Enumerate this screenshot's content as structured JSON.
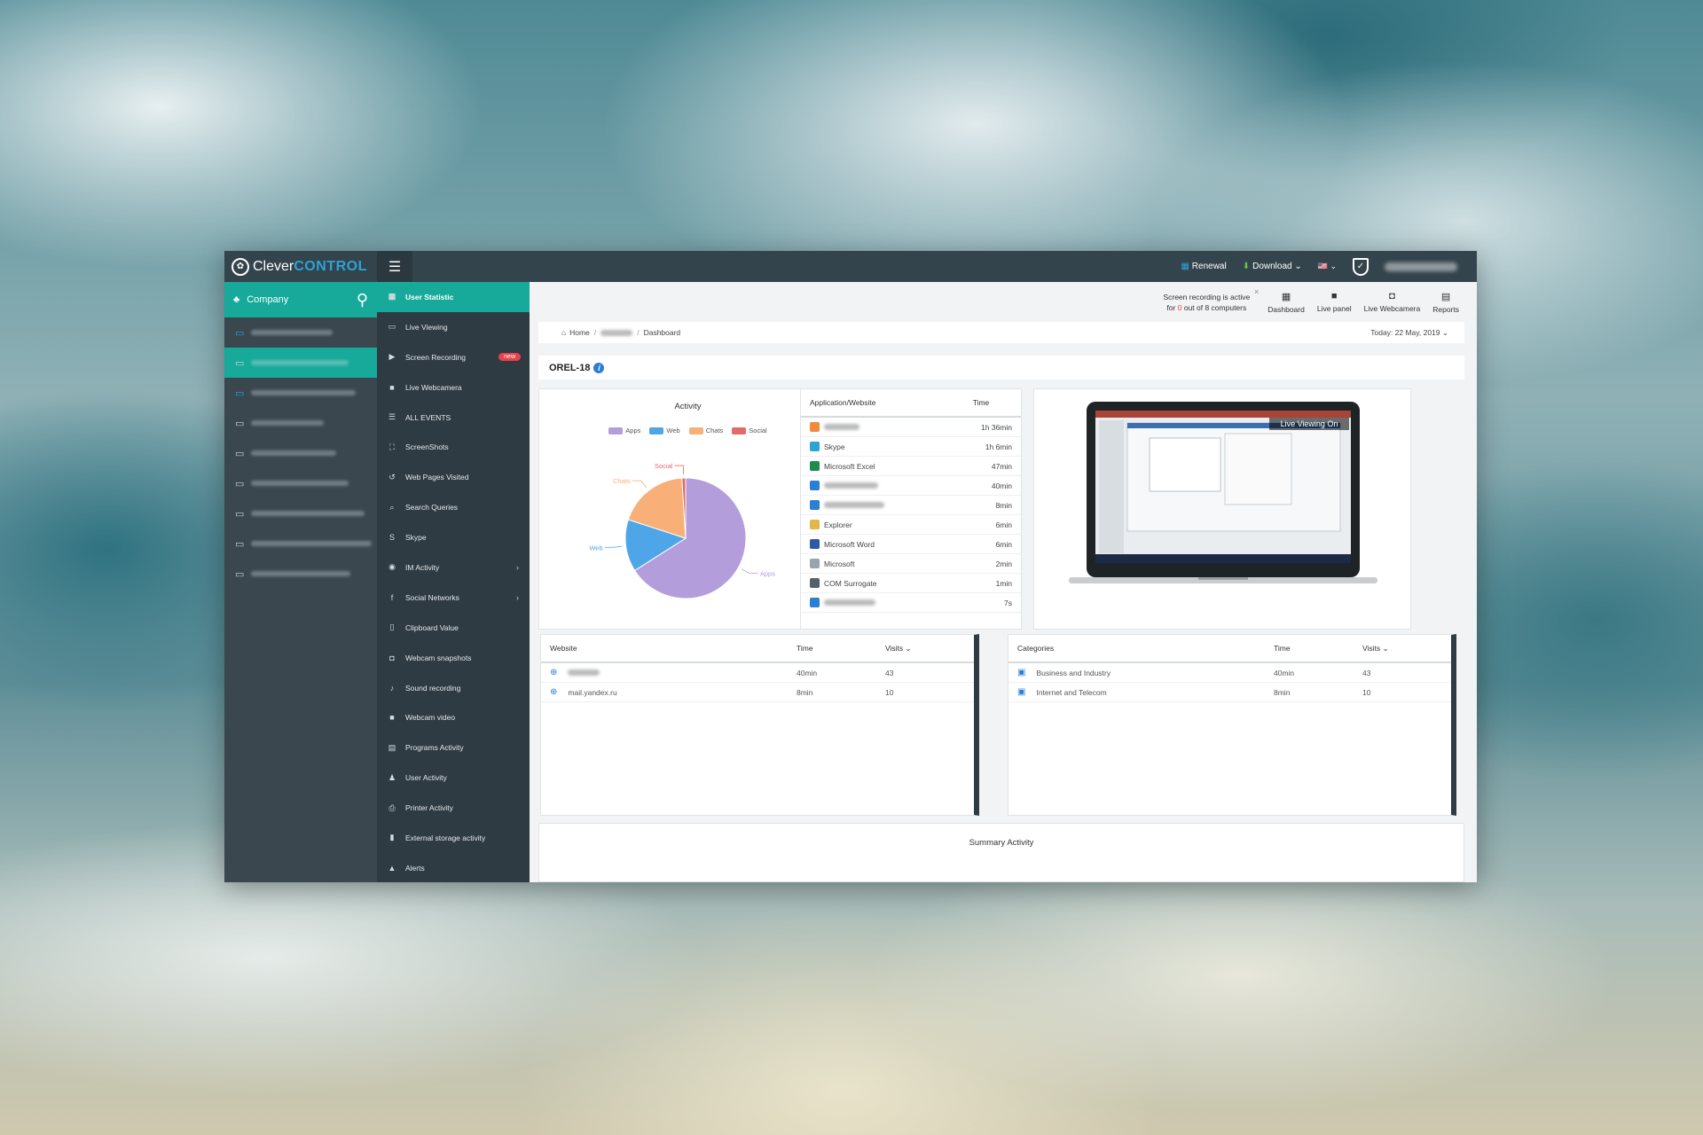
{
  "app": {
    "logo_prefix": "Clever",
    "logo_accent": "CONTROL",
    "menu_icon": "hamburger-icon"
  },
  "topbar": {
    "renewal": "Renewal",
    "download": "Download ⌄",
    "language": "🇺🇸 ⌄"
  },
  "company": {
    "label": "Company"
  },
  "computers_count": 9,
  "menu": [
    {
      "label": "User Statistic",
      "icon": "▦"
    },
    {
      "label": "Live Viewing",
      "icon": "▭"
    },
    {
      "label": "Screen Recording",
      "icon": "▶",
      "badge": "new"
    },
    {
      "label": "Live Webcamera",
      "icon": "■"
    },
    {
      "label": "ALL EVENTS",
      "icon": "☰"
    },
    {
      "label": "ScreenShots",
      "icon": "⛶"
    },
    {
      "label": "Web Pages Visited",
      "icon": "↺"
    },
    {
      "label": "Search Queries",
      "icon": "⌕"
    },
    {
      "label": "Skype",
      "icon": "S"
    },
    {
      "label": "IM Activity",
      "icon": "◉",
      "chevron": "›"
    },
    {
      "label": "Social Networks",
      "icon": "f",
      "chevron": "›"
    },
    {
      "label": "Clipboard Value",
      "icon": "▯"
    },
    {
      "label": "Webcam snapshots",
      "icon": "◘"
    },
    {
      "label": "Sound recording",
      "icon": "♪"
    },
    {
      "label": "Webcam video",
      "icon": "■"
    },
    {
      "label": "Programs Activity",
      "icon": "▤"
    },
    {
      "label": "User Activity",
      "icon": "♟"
    },
    {
      "label": "Printer Activity",
      "icon": "⎙"
    },
    {
      "label": "External storage activity",
      "icon": "▮"
    },
    {
      "label": "Alerts",
      "icon": "▲"
    }
  ],
  "info_strip": {
    "rec_line1": "Screen recording is active",
    "rec_prefix": "for",
    "rec_count": "0",
    "rec_suffix": "out of 8 computers",
    "close": "×",
    "quick_links": [
      {
        "label": "Dashboard",
        "icon": "▦"
      },
      {
        "label": "Live panel",
        "icon": "■"
      },
      {
        "label": "Live Webcamera",
        "icon": "◘"
      },
      {
        "label": "Reports",
        "icon": "▤"
      }
    ]
  },
  "breadcrumb": {
    "home": "Home",
    "current": "Dashboard",
    "sep": "/",
    "today": "Today: 22 May, 2019 ⌄"
  },
  "host": {
    "name": "OREL-18",
    "info": "i"
  },
  "activity": {
    "title": "Activity"
  },
  "chart_data": {
    "type": "pie",
    "title": "Activity",
    "labels": [
      "Apps",
      "Web",
      "Chats",
      "Social"
    ],
    "values": [
      66,
      14,
      19,
      1
    ],
    "colors": [
      "#b39ddb",
      "#4ea6e8",
      "#f8b078",
      "#e46a6a"
    ],
    "legend_position": "top"
  },
  "apps_table": {
    "col_app": "Application/Website",
    "col_time": "Time",
    "rows": [
      {
        "name": "",
        "time": "1h 36min",
        "icon": "app-icon",
        "color": "#f08a3c"
      },
      {
        "name": "Skype",
        "time": "1h 6min",
        "icon": "skype-icon",
        "color": "#2aa4d5"
      },
      {
        "name": "Microsoft Excel",
        "time": "47min",
        "icon": "excel-icon",
        "color": "#1f8b4c"
      },
      {
        "name": "",
        "time": "40min",
        "icon": "globe-icon",
        "color": "#2a7fd4"
      },
      {
        "name": "",
        "time": "8min",
        "icon": "globe-icon",
        "color": "#2a7fd4"
      },
      {
        "name": "Explorer",
        "time": "6min",
        "icon": "folder-icon",
        "color": "#e3b64c"
      },
      {
        "name": "Microsoft Word",
        "time": "6min",
        "icon": "word-icon",
        "color": "#2b5aa8"
      },
      {
        "name": "Microsoft",
        "time": "2min",
        "icon": "app-icon",
        "color": "#9aa4aa"
      },
      {
        "name": "COM Surrogate",
        "time": "1min",
        "icon": "window-icon",
        "color": "#556068"
      },
      {
        "name": "",
        "time": "7s",
        "icon": "globe-icon",
        "color": "#2a7fd4"
      }
    ]
  },
  "live_viewing": {
    "label": "Live Viewing On"
  },
  "website_table": {
    "col_site": "Website",
    "col_time": "Time",
    "col_visits": "Visits ⌄",
    "rows": [
      {
        "site": "",
        "time": "40min",
        "visits": "43"
      },
      {
        "site": "mail.yandex.ru",
        "time": "8min",
        "visits": "10"
      }
    ]
  },
  "categories_table": {
    "col_cat": "Categories",
    "col_time": "Time",
    "col_visits": "Visits ⌄",
    "rows": [
      {
        "cat": "Business and Industry",
        "time": "40min",
        "visits": "43"
      },
      {
        "cat": "Internet and Telecom",
        "time": "8min",
        "visits": "10"
      }
    ]
  },
  "summary": {
    "title": "Summary Activity"
  }
}
